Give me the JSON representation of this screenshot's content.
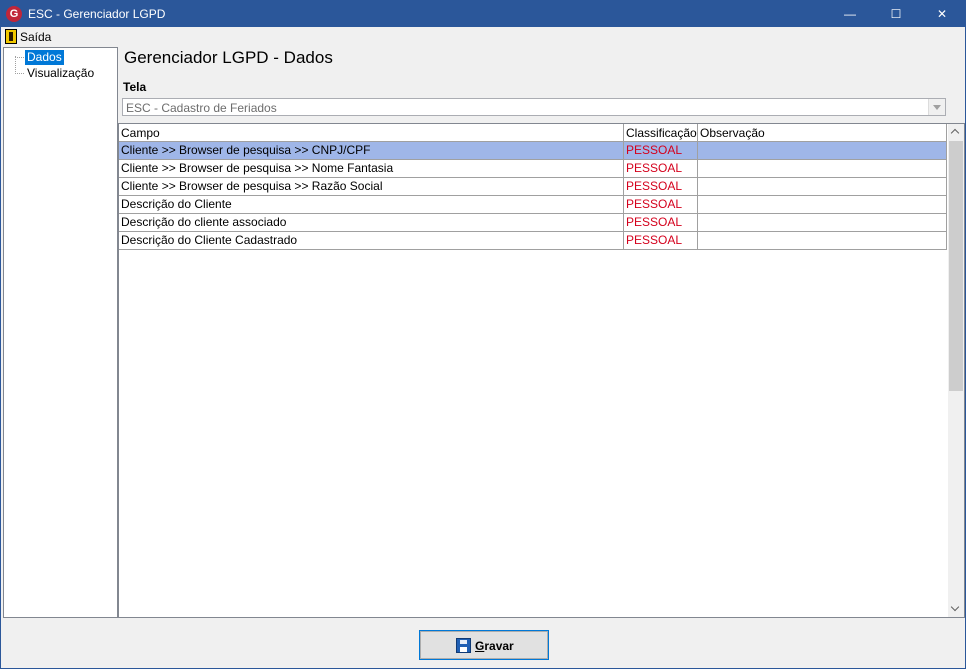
{
  "window": {
    "title": "ESC - Gerenciador LGPD",
    "app_icon_letter": "G",
    "min_glyph": "—",
    "max_glyph": "☐",
    "close_glyph": "✕"
  },
  "menu": {
    "items": [
      {
        "label": "Saída",
        "icon": "exit-door-icon"
      }
    ]
  },
  "tree": {
    "items": [
      {
        "label": "Dados",
        "selected": true
      },
      {
        "label": "Visualização",
        "selected": false
      }
    ]
  },
  "main": {
    "title": "Gerenciador LGPD - Dados",
    "screen_label": "Tela",
    "screen_select_value": "ESC - Cadastro de Feriados"
  },
  "grid": {
    "columns": [
      "Campo",
      "Classificação",
      "Observação"
    ],
    "rows": [
      {
        "campo": "Cliente >> Browser de pesquisa >> CNPJ/CPF",
        "classificacao": "PESSOAL",
        "observacao": ""
      },
      {
        "campo": "Cliente >> Browser de pesquisa >> Nome Fantasia",
        "classificacao": "PESSOAL",
        "observacao": ""
      },
      {
        "campo": "Cliente >> Browser de pesquisa >> Razão Social",
        "classificacao": "PESSOAL",
        "observacao": ""
      },
      {
        "campo": "Descrição do Cliente",
        "classificacao": "PESSOAL",
        "observacao": ""
      },
      {
        "campo": "Descrição do cliente associado",
        "classificacao": "PESSOAL",
        "observacao": ""
      },
      {
        "campo": "Descrição do Cliente Cadastrado",
        "classificacao": "PESSOAL",
        "observacao": ""
      }
    ],
    "selected_row": 0
  },
  "footer": {
    "save_mnemonic": "G",
    "save_rest": "ravar",
    "save_icon": "floppy-disk-icon"
  },
  "colors": {
    "titlebar": "#2b579a",
    "selected_row": "#9fb6e8",
    "classification_text": "#d4001c",
    "tree_selection": "#0078d7"
  }
}
